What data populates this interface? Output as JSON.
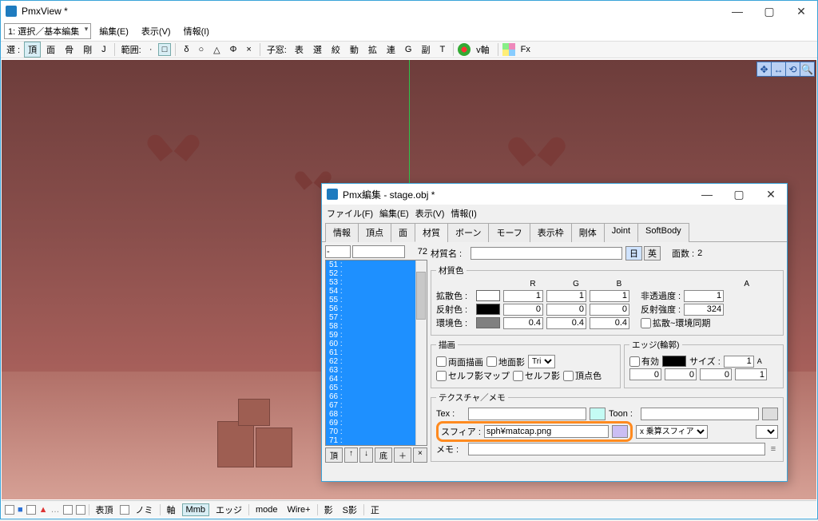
{
  "mainWindow": {
    "title": "PmxView *",
    "modeDropdown": "1: 選択／基本編集",
    "menus": [
      "編集(E)",
      "表示(V)",
      "情報(I)"
    ]
  },
  "toolbar": {
    "sel": "選 :",
    "items1": [
      "頂",
      "面",
      "骨",
      "剛",
      "J"
    ],
    "range": "範囲:",
    "sym": [
      "δ",
      "○",
      "△",
      "Φ",
      "×"
    ],
    "child": "子窓:",
    "items2": [
      "表",
      "選",
      "絞",
      "動",
      "拡",
      "連",
      "G",
      "副",
      "T"
    ],
    "vaxis": "v軸",
    "fx": "Fx"
  },
  "statusbar": {
    "items": [
      "表頂",
      "ノミ",
      "軸",
      "Mmb",
      "エッジ",
      "mode",
      "Wire+",
      "影",
      "S影",
      "正"
    ],
    "blue": "■",
    "red": "▲"
  },
  "childWindow": {
    "title": "Pmx編集 - stage.obj *",
    "menus": [
      "ファイル(F)",
      "編集(E)",
      "表示(V)",
      "情報(I)"
    ],
    "tabs": [
      "情報",
      "頂点",
      "面",
      "材質",
      "ボーン",
      "モーフ",
      "表示枠",
      "剛体",
      "Joint",
      "SoftBody"
    ],
    "activeTab": 3,
    "materialList": {
      "count": "72",
      "topField": "-",
      "items": [
        "51 :",
        "52 :",
        "53 :",
        "54 :",
        "55 :",
        "56 :",
        "57 :",
        "58 :",
        "59 :",
        "60 :",
        "61 :",
        "62 :",
        "63 :",
        "64 :",
        "65 :",
        "66 :",
        "67 :",
        "68 :",
        "69 :",
        "70 :",
        "71 :"
      ],
      "footer": [
        "頂",
        "↑",
        "↓",
        "底",
        "＋",
        "×"
      ]
    },
    "material": {
      "nameLabel": "材質名 :",
      "nameValue": "",
      "langBtns": [
        "日",
        "英"
      ],
      "faceCountLabel": "面数 :",
      "faceCount": "2",
      "colorGroup": "材質色",
      "headers": [
        "R",
        "G",
        "B"
      ],
      "diffuseLabel": "拡散色 :",
      "diffuse": {
        "swatch": "#ffffff",
        "r": "1",
        "g": "1",
        "b": "1"
      },
      "alphaLabel": "非透過度 :",
      "alpha": "1",
      "specularLabel": "反射色 :",
      "specular": {
        "swatch": "#000000",
        "r": "0",
        "g": "0",
        "b": "0"
      },
      "shininessLabel": "反射強度 :",
      "shininess": "324",
      "ambientLabel": "環境色 :",
      "ambient": {
        "swatch": "#808080",
        "r": "0.4",
        "g": "0.4",
        "b": "0.4"
      },
      "syncLabel": "拡散~環境同期",
      "drawGroup": "描画",
      "drawChecks": [
        "両面描画",
        "地面影",
        "セルフ影マップ",
        "セルフ影",
        "頂点色"
      ],
      "triSel": "Tri",
      "edgeGroup": "エッジ(輪郭)",
      "edgeEnable": "有効",
      "edgeSizeLabel": "サイズ :",
      "edge": {
        "swatch": "#000000",
        "size": "1",
        "r": "0",
        "g": "0",
        "b": "0",
        "a": "1"
      },
      "aSuffix": "A",
      "texGroup": "テクスチャ／メモ",
      "texLabel": "Tex :",
      "tex": "",
      "toonLabel": "Toon :",
      "toon": "",
      "sphLabel": "スフィア :",
      "sph": "sph¥matcap.png",
      "sphModeLabel": "x 乗算スフィア",
      "memoLabel": "メモ :",
      "memo": ""
    }
  }
}
